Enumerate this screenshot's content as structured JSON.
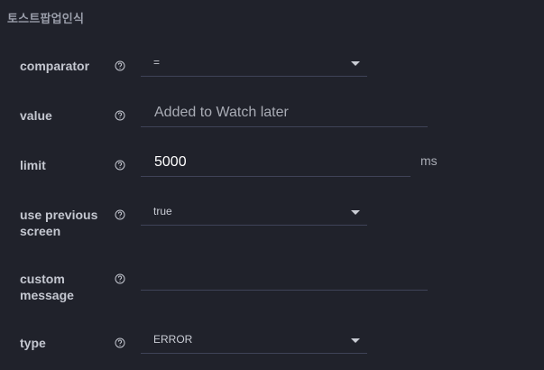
{
  "section": {
    "title": "토스트팝업인식"
  },
  "fields": {
    "comparator": {
      "label": "comparator",
      "value": "="
    },
    "value": {
      "label": "value",
      "value": "Added to Watch later"
    },
    "limit": {
      "label": "limit",
      "value": "5000",
      "unit": "ms"
    },
    "use_previous_screen": {
      "label_line1": "use previous",
      "label_line2": "screen",
      "value": "true"
    },
    "custom_message": {
      "label_line1": "custom",
      "label_line2": "message",
      "value": ""
    },
    "type": {
      "label": "type",
      "value": "ERROR"
    }
  },
  "icons": {
    "help": "help-circle-icon",
    "dropdown": "caret-down-icon"
  },
  "colors": {
    "background": "#20222b",
    "label": "#c4c7d0",
    "underline": "#3f4358",
    "muted": "#9a9eaa"
  }
}
